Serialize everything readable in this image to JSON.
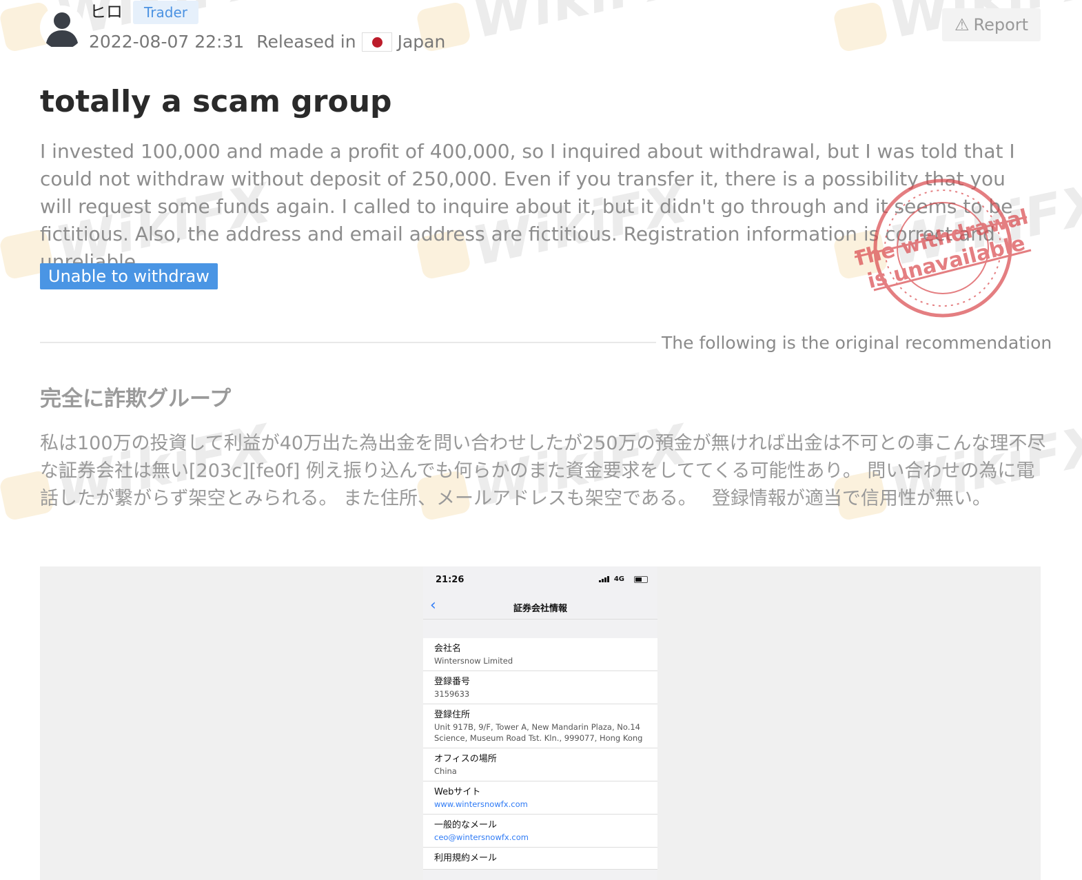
{
  "header": {
    "username": "ヒロ",
    "badge": "Trader",
    "datetime": "2022-08-07 22:31",
    "released_in": "Released in",
    "country": "Japan",
    "report": "Report"
  },
  "review": {
    "title": "totally a scam group",
    "body": "I invested 100,000 and made a profit of 400,000, so I inquired about withdrawal, but I was told that I could not withdraw without deposit of 250,000.  Even if you transfer it, there is a possibility that you will request some funds again. I called to inquire about it, but it didn't go through and it seems to be fictitious. Also, the address and email address are fictitious. Registration information is correct and unreliable.",
    "tag": "Unable to withdraw",
    "stamp_line1": "The withdrawal",
    "stamp_line2": "is unavailable"
  },
  "original": {
    "note": "The following is the original recommendation",
    "title": "完全に詐欺グループ",
    "body": "私は100万の投資して利益が40万出た為出金を問い合わせしたが250万の預金が無ければ出金は不可との事こんな理不尽な証券会社は無い[203c][fe0f] 例え振り込んでも何らかのまた資金要求をしててくる可能性あり。 問い合わせの為に電話したが繋がらず架空とみられる。 また住所、メールアドレスも架空である。　 登録情報が適当で信用性が無い。"
  },
  "phone": {
    "time": "21:26",
    "network": "4G",
    "nav_title": "証券会社情報",
    "rows": [
      {
        "label": "会社名",
        "value": "Wintersnow Limited"
      },
      {
        "label": "登録番号",
        "value": "3159633"
      },
      {
        "label": "登録住所",
        "value": "Unit 917B, 9/F, Tower A, New Mandarin Plaza, No.14 Science, Museum Road Tst. Kln., 999077, Hong Kong"
      },
      {
        "label": "オフィスの場所",
        "value": "China"
      },
      {
        "label": "Webサイト",
        "value": "www.wintersnowfx.com"
      },
      {
        "label": "一般的なメール",
        "value": "ceo@wintersnowfx.com"
      },
      {
        "label": "利用規約メール",
        "value": ""
      }
    ]
  },
  "watermark": "WikiFX",
  "colors": {
    "accent": "#4a95e4",
    "badge_bg": "#e6f0fb",
    "stamp": "#d9484c",
    "flag_red": "#bc1c2a"
  }
}
